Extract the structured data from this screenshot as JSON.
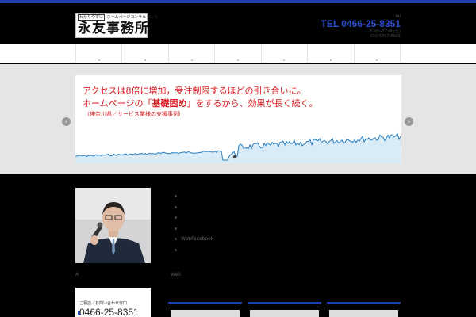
{
  "header": {
    "logo_tagline_boxed": "わかりやすい",
    "logo_tagline": "ホームページコンサルタント",
    "logo_name": "永友事務所",
    "tel_label": "tel",
    "tel": "TEL 0466-25-8351",
    "tel_sub_1": "8:00～17:00(土)",
    "tel_sub_2": "050-5357-8901"
  },
  "nav": {
    "items": [
      {
        "label": ""
      },
      {
        "label": ""
      },
      {
        "label": ""
      },
      {
        "label": ""
      },
      {
        "label": ""
      },
      {
        "label": ""
      },
      {
        "label": ""
      }
    ]
  },
  "slider": {
    "line1": "アクセスは8倍に増加，受注制限するほどの引き合いに。",
    "line2_before": "ホームページの「",
    "line2_bold": "基礎固め",
    "line2_after": "」をするから、効果が長く続く。",
    "line3": "（神奈川県／サービス業様の支援事例）",
    "prev_icon": "chevron-left-icon",
    "next_icon": "chevron-right-icon",
    "prev_glyph": "‹",
    "next_glyph": "›"
  },
  "main": {
    "bullets": [
      "",
      "",
      "",
      "",
      "WebFacebook",
      ""
    ],
    "caption_a": "A",
    "caption_web": "Web",
    "consult_label": "ご相談／お問い合わせ窓口",
    "consult_tel": "0466-25-8351"
  },
  "colors": {
    "accent": "#1c3fb0",
    "tel": "#2a4dc8",
    "slide_text": "#d7191f",
    "graph_line": "#2a7fc0",
    "graph_fill": "#d9ebf7"
  }
}
